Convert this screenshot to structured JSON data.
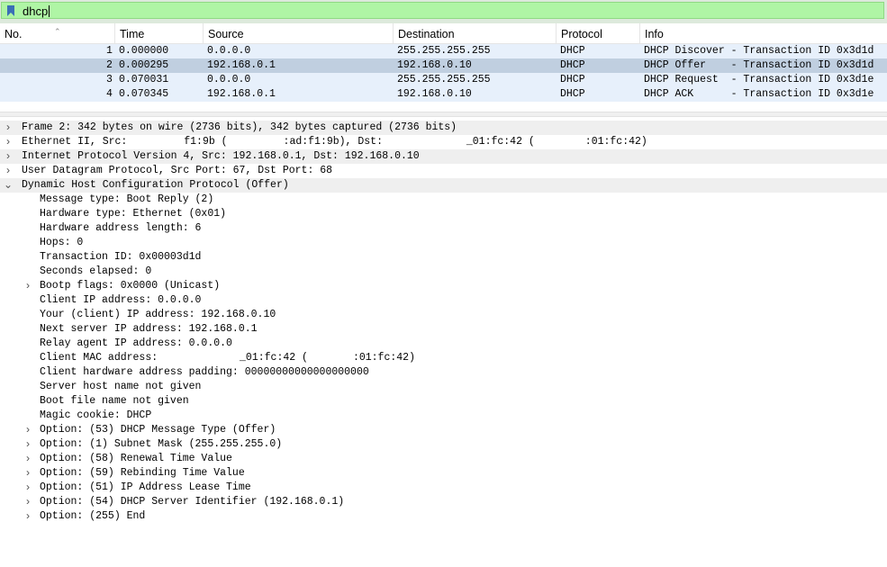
{
  "filter": {
    "text": "dhcp"
  },
  "columns": [
    "No.",
    "Time",
    "Source",
    "Destination",
    "Protocol",
    "Info"
  ],
  "packets": [
    {
      "no": "1",
      "time": "0.000000",
      "source": "0.0.0.0",
      "destination": "255.255.255.255",
      "protocol": "DHCP",
      "info": "DHCP Discover - Transaction ID 0x3d1d"
    },
    {
      "no": "2",
      "time": "0.000295",
      "source": "192.168.0.1",
      "destination": "192.168.0.10",
      "protocol": "DHCP",
      "info": "DHCP Offer    - Transaction ID 0x3d1d"
    },
    {
      "no": "3",
      "time": "0.070031",
      "source": "0.0.0.0",
      "destination": "255.255.255.255",
      "protocol": "DHCP",
      "info": "DHCP Request  - Transaction ID 0x3d1e"
    },
    {
      "no": "4",
      "time": "0.070345",
      "source": "192.168.0.1",
      "destination": "192.168.0.10",
      "protocol": "DHCP",
      "info": "DHCP ACK      - Transaction ID 0x3d1e"
    }
  ],
  "details": {
    "frame": "Frame 2: 342 bytes on wire (2736 bits), 342 bytes captured (2736 bits)",
    "ethernet": {
      "a": "Ethernet II, Src: ",
      "b": "f1:9b (",
      "c": ":ad:f1:9b), Dst: ",
      "d": "_01:fc:42 (",
      "e": ":01:fc:42)"
    },
    "ip": "Internet Protocol Version 4, Src: 192.168.0.1, Dst: 192.168.0.10",
    "udp": "User Datagram Protocol, Src Port: 67, Dst Port: 68",
    "dhcp": "Dynamic Host Configuration Protocol (Offer)",
    "fields": [
      "Message type: Boot Reply (2)",
      "Hardware type: Ethernet (0x01)",
      "Hardware address length: 6",
      "Hops: 0",
      "Transaction ID: 0x00003d1d",
      "Seconds elapsed: 0"
    ],
    "bootp_flags": "Bootp flags: 0x0000 (Unicast)",
    "fields2": [
      "Client IP address: 0.0.0.0",
      "Your (client) IP address: 192.168.0.10",
      "Next server IP address: 192.168.0.1",
      "Relay agent IP address: 0.0.0.0"
    ],
    "client_mac": {
      "a": "Client MAC address: ",
      "b": "_01:fc:42 (",
      "c": ":01:fc:42)"
    },
    "fields3": [
      "Client hardware address padding: 00000000000000000000",
      "Server host name not given",
      "Boot file name not given",
      "Magic cookie: DHCP"
    ],
    "options": [
      "Option: (53) DHCP Message Type (Offer)",
      "Option: (1) Subnet Mask (255.255.255.0)",
      "Option: (58) Renewal Time Value",
      "Option: (59) Rebinding Time Value",
      "Option: (51) IP Address Lease Time",
      "Option: (54) DHCP Server Identifier (192.168.0.1)",
      "Option: (255) End"
    ]
  },
  "colors": {
    "filter_bg": "#aff5a5",
    "row_bg": "#e7f0fb",
    "row_selected": "#c0cfe0"
  }
}
